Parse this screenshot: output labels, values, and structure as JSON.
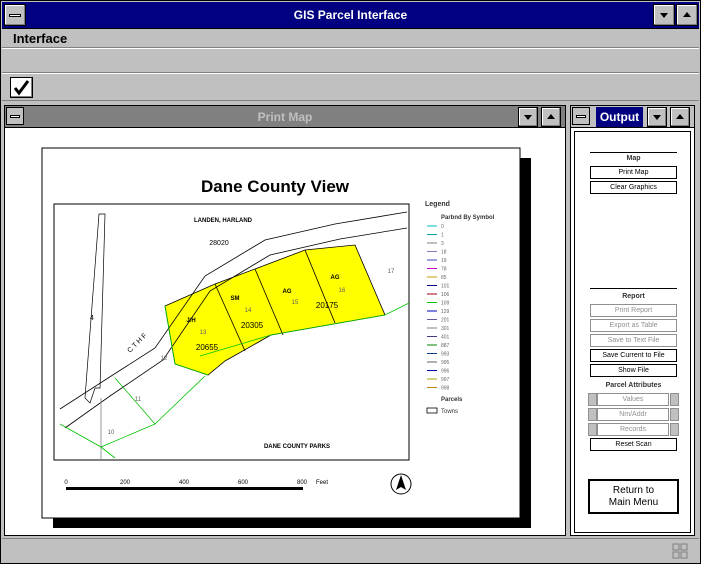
{
  "app": {
    "title": "GIS Parcel Interface"
  },
  "menu": {
    "items": [
      "Interface"
    ]
  },
  "toolbar": {
    "check_icon": "checkmark-icon"
  },
  "print_map": {
    "title": "Print Map",
    "map_title": "Dane County View",
    "labels": {
      "landen": "LANDEN, HARLAND",
      "parks": "DANE COUNTY PARKS",
      "cth": "C T H  F",
      "p28020": "28020",
      "p20305": "20305",
      "p20175": "20175",
      "p20655": "20655",
      "jh": "J/H",
      "sm": "SM",
      "ag1": "AG",
      "ag2": "AG",
      "n13": "13",
      "n14": "14",
      "n15": "15",
      "n16": "16",
      "n17": "17",
      "n12": "12",
      "n11": "11",
      "n10": "10",
      "n4": "4"
    },
    "legend": {
      "title": "Legend",
      "subtitle": "Parbnd By Symbol",
      "entries": [
        {
          "label": "0",
          "color": "#00c0c0"
        },
        {
          "label": "1",
          "color": "#00a0a0"
        },
        {
          "label": "3",
          "color": "#808080"
        },
        {
          "label": "18",
          "color": "#8080c0"
        },
        {
          "label": "19",
          "color": "#4040c0"
        },
        {
          "label": "78",
          "color": "#c000c0"
        },
        {
          "label": "85",
          "color": "#c0a000"
        },
        {
          "label": "101",
          "color": "#000080"
        },
        {
          "label": "106",
          "color": "#a00000"
        },
        {
          "label": "109",
          "color": "#00c000"
        },
        {
          "label": "129",
          "color": "#0000c0"
        },
        {
          "label": "201",
          "color": "#6060a0"
        },
        {
          "label": "301",
          "color": "#808080"
        },
        {
          "label": "401",
          "color": "#404080"
        },
        {
          "label": "887",
          "color": "#008000"
        },
        {
          "label": "993",
          "color": "#004080"
        },
        {
          "label": "995",
          "color": "#606060"
        },
        {
          "label": "996",
          "color": "#0000a0"
        },
        {
          "label": "997",
          "color": "#a0a000"
        },
        {
          "label": "998",
          "color": "#c08000"
        }
      ],
      "parcels_title": "Parcels",
      "towns_label": "Towns"
    },
    "scale": {
      "ticks": [
        "0",
        "200",
        "400",
        "600",
        "800"
      ],
      "unit": "Feet"
    }
  },
  "output": {
    "title": "Output",
    "map_section": "Map",
    "print_map": "Print Map",
    "clear_graphics": "Clear Graphics",
    "report_section": "Report",
    "print_report": "Print Report",
    "export_table": "Export as Table",
    "save_text": "Save to Text File",
    "save_current": "Save Current to File",
    "show_file": "Show File",
    "attr_section": "Parcel Attributes",
    "values": "Values",
    "nm_addr": "Nm/Addr",
    "records": "Records",
    "reset_scan": "Reset Scan",
    "return_line1": "Return to",
    "return_line2": "Main Menu"
  },
  "colors": {
    "titlebar": "#000080",
    "parcel_fill": "#ffff00",
    "panel": "#c0c0c0"
  }
}
